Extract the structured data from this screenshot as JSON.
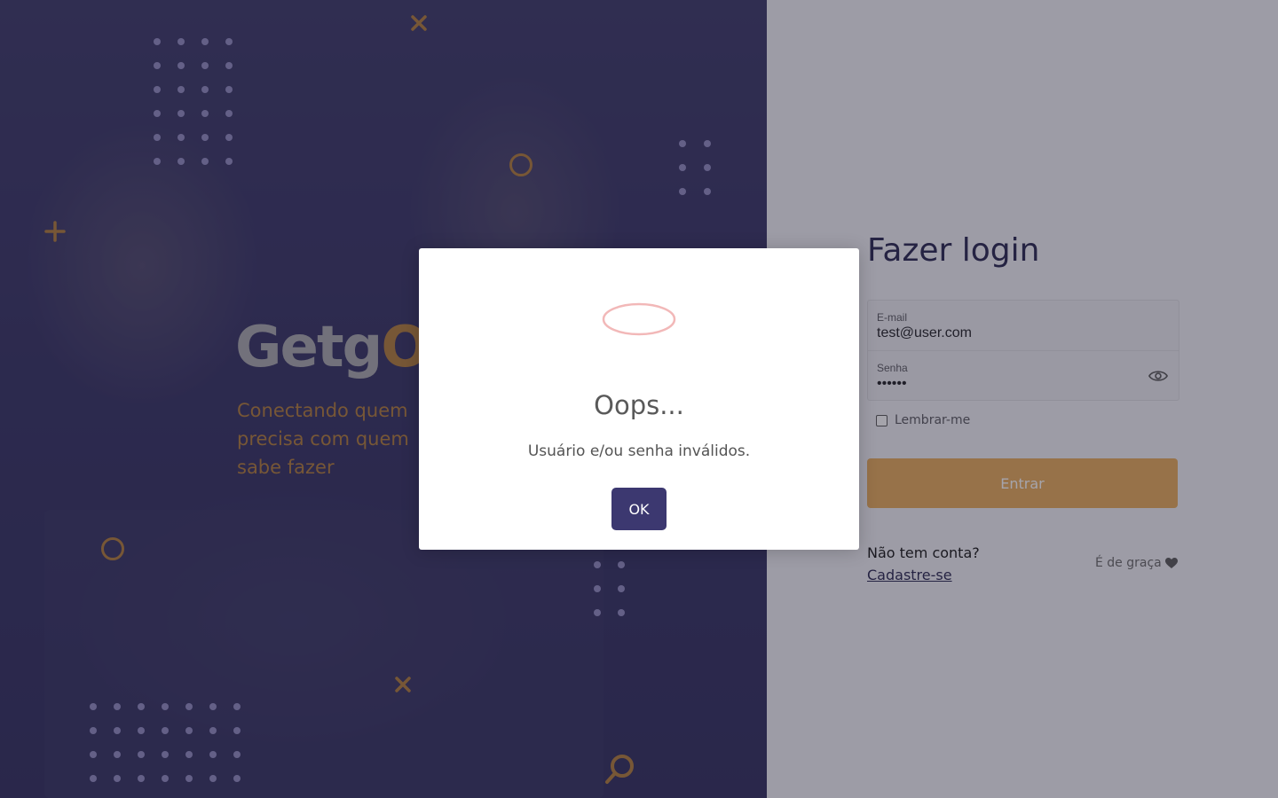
{
  "hero": {
    "logo_main": "Getg",
    "logo_accent": "O",
    "tagline": "Conectando quem precisa com quem sabe fazer"
  },
  "login": {
    "title": "Fazer login",
    "email": {
      "label": "E-mail",
      "value": "test@user.com"
    },
    "password": {
      "label": "Senha",
      "value": "••••••"
    },
    "remember_label": "Lembrar-me",
    "submit_label": "Entrar",
    "signup_question": "Não tem conta?",
    "signup_link": "Cadastre-se",
    "free_label": "É de graça"
  },
  "modal": {
    "title": "Oops...",
    "message": "Usuário e/ou senha inválidos.",
    "ok_label": "OK"
  },
  "colors": {
    "brand_purple": "#3c3870",
    "brand_orange": "#b07a36",
    "button_orange": "#e7aa57",
    "error_ring": "#f2b8b8"
  },
  "icons": [
    "eye-icon",
    "heart-icon",
    "close-icon",
    "plus-icon",
    "search-icon",
    "error-icon"
  ]
}
